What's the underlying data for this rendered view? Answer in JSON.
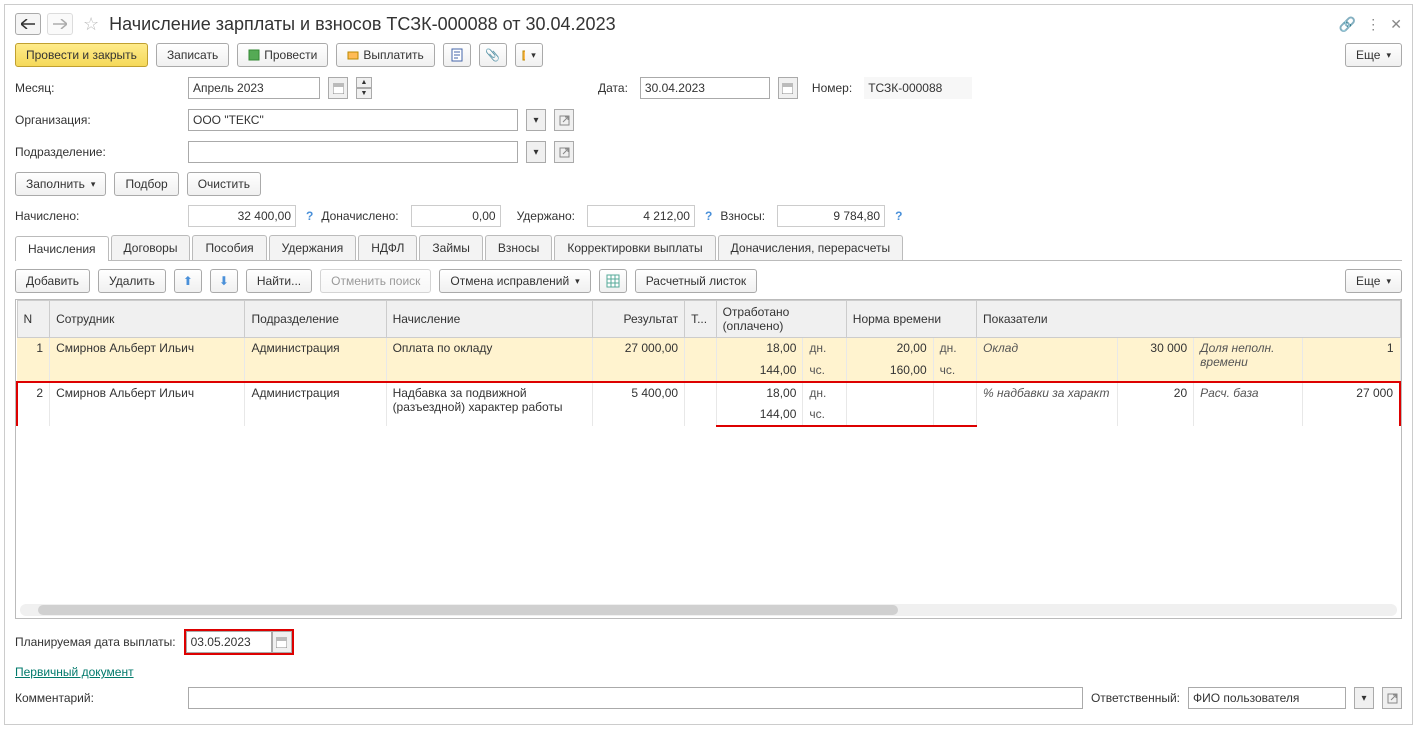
{
  "header": {
    "title": "Начисление зарплаты и взносов ТСЗК-000088 от 30.04.2023"
  },
  "toolbar": {
    "post_close": "Провести и закрыть",
    "write": "Записать",
    "post": "Провести",
    "pay": "Выплатить",
    "more": "Еще"
  },
  "form": {
    "month_lbl": "Месяц:",
    "month_val": "Апрель 2023",
    "date_lbl": "Дата:",
    "date_val": "30.04.2023",
    "number_lbl": "Номер:",
    "number_val": "ТСЗК-000088",
    "org_lbl": "Организация:",
    "org_val": "ООО \"ТЕКС\"",
    "dept_lbl": "Подразделение:",
    "dept_val": "",
    "fill": "Заполнить",
    "pick": "Подбор",
    "clear": "Очистить",
    "accrued_lbl": "Начислено:",
    "accrued_val": "32 400,00",
    "addl_lbl": "Доначислено:",
    "addl_val": "0,00",
    "withheld_lbl": "Удержано:",
    "withheld_val": "4 212,00",
    "contrib_lbl": "Взносы:",
    "contrib_val": "9 784,80"
  },
  "tabs": {
    "t0": "Начисления",
    "t1": "Договоры",
    "t2": "Пособия",
    "t3": "Удержания",
    "t4": "НДФЛ",
    "t5": "Займы",
    "t6": "Взносы",
    "t7": "Корректировки выплаты",
    "t8": "Доначисления, перерасчеты"
  },
  "tabtb": {
    "add": "Добавить",
    "del": "Удалить",
    "find": "Найти...",
    "cancel_find": "Отменить поиск",
    "cancel_fix": "Отмена исправлений",
    "payslip": "Расчетный листок",
    "more": "Еще"
  },
  "cols": {
    "n": "N",
    "emp": "Сотрудник",
    "dept": "Подразделение",
    "accr": "Начисление",
    "res": "Результат",
    "t": "Т...",
    "worked": "Отработано (оплачено)",
    "norm": "Норма времени",
    "ind": "Показатели"
  },
  "rows": [
    {
      "n": "1",
      "emp": "Смирнов Альберт Ильич",
      "dept": "Администрация",
      "accr": "Оплата по окладу",
      "res": "27 000,00",
      "wd": "18,00",
      "wu": "дн.",
      "wd2": "144,00",
      "wu2": "чс.",
      "nd": "20,00",
      "nu": "дн.",
      "nd2": "160,00",
      "nu2": "чс.",
      "i1n": "Оклад",
      "i1v": "30 000",
      "i2n": "Доля неполн. времени",
      "i2v": "1"
    },
    {
      "n": "2",
      "emp": "Смирнов Альберт Ильич",
      "dept": "Администрация",
      "accr": "Надбавка за подвижной (разъездной) характер работы",
      "res": "5 400,00",
      "wd": "18,00",
      "wu": "дн.",
      "wd2": "144,00",
      "wu2": "чс.",
      "nd": "",
      "nu": "",
      "nd2": "",
      "nu2": "",
      "i1n": "% надбавки за характ",
      "i1v": "20",
      "i2n": "Расч. база",
      "i2v": "27 000"
    }
  ],
  "footer": {
    "plan_lbl": "Планируемая дата выплаты:",
    "plan_val": "03.05.2023",
    "primary_doc": "Первичный документ",
    "comment_lbl": "Комментарий:",
    "comment_val": "",
    "resp_lbl": "Ответственный:",
    "resp_val": "ФИО пользователя"
  }
}
